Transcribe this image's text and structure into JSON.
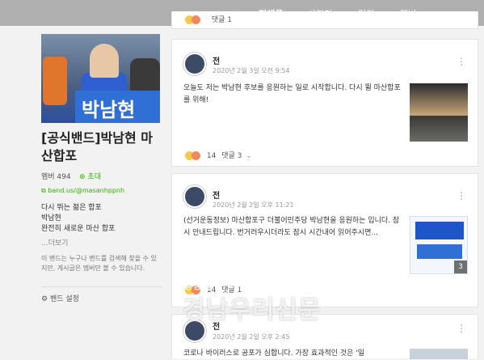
{
  "top_nav": {
    "tabs": [
      {
        "label": "전체글",
        "active": true
      },
      {
        "label": "사진첩",
        "active": false
      },
      {
        "label": "일정",
        "active": false
      },
      {
        "label": "멤버",
        "active": false
      }
    ]
  },
  "sidebar": {
    "title": "[공식밴드]박남현 마산합포",
    "member_label": "멤버 494",
    "invite_label": "초대",
    "band_url": "band.us/@masanhppnh",
    "description": [
      "다시 뛰는 젊은 합포",
      "박남현",
      "완전히 새로운 마산 합포"
    ],
    "more_label": "...더보기",
    "notice": "이 밴드는 누구나 밴드를 검색해 찾을 수 있지만, 게시글은 멤버만 볼 수 있습니다.",
    "settings_label": "밴드 설정"
  },
  "posts": [
    {
      "author": "전",
      "date": "2020년 2월 3일 오전 9:54",
      "text": "오늘도 저는 박남현 후보를 응원하는 일로 시작합니다.  다시 뛸 마산합포를 위해!",
      "reactions": "14",
      "comments": "댓글 3"
    },
    {
      "author": "전",
      "date": "2020년 2월 2일 오후 11:21",
      "text": "(선거운동정보) 마산합포구 더불어민주당 박남현을 응원하는 입니다.  잠시 안내드립니다. 번거러우시더라도 잠시 시간내어 읽어주시면...",
      "reactions": "14",
      "comments": "댓글 1",
      "photo_count": "3"
    },
    {
      "author": "전",
      "date": "2020년 2월 2일 오후 2:45",
      "text": "코로나 바이러스로 공포가 심합니다. 가장 효과적인 것은 '일"
    }
  ],
  "top_partial": {
    "comments": "댓글 1"
  },
  "watermark": {
    "line1": "경남 창출 시사 주간지",
    "line2": "경남우리신문"
  },
  "colors": {
    "accent": "#2db400",
    "nav_bg": "#b0b0b0"
  }
}
